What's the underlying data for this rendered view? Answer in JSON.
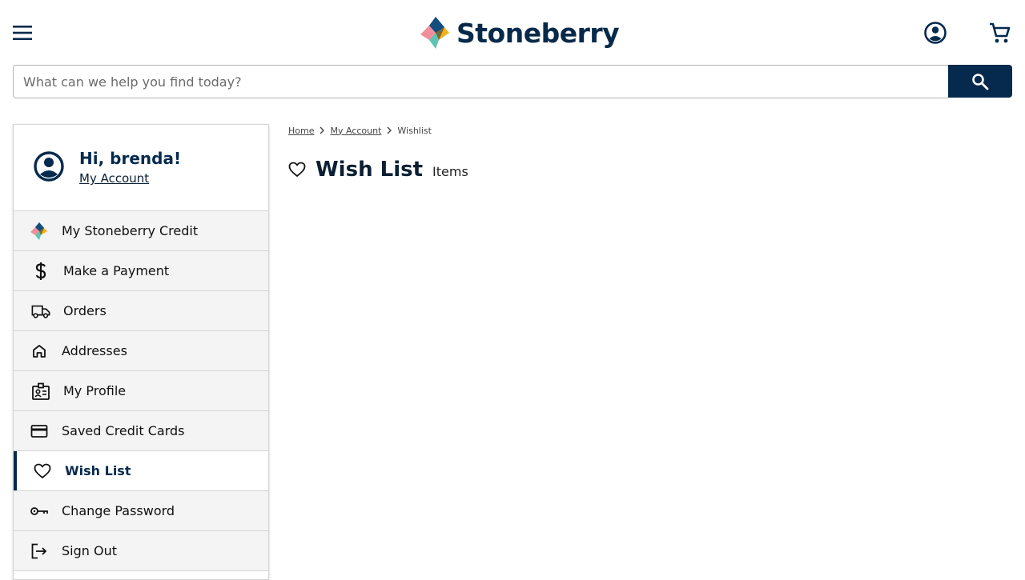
{
  "header": {
    "brand": "Stoneberry",
    "menu_icon": "hamburger-menu-icon",
    "account_icon": "account-circle-icon",
    "cart_icon": "shopping-cart-icon"
  },
  "search": {
    "placeholder": "What can we help you find today?",
    "value": "",
    "icon": "search-icon"
  },
  "sidebar": {
    "greeting": "Hi, brenda!",
    "account_link": "My Account",
    "items": [
      {
        "label": "My Stoneberry Credit",
        "icon": "stoneberry-logo-icon"
      },
      {
        "label": "Make a Payment",
        "icon": "dollar-icon"
      },
      {
        "label": "Orders",
        "icon": "truck-icon"
      },
      {
        "label": "Addresses",
        "icon": "home-icon"
      },
      {
        "label": "My Profile",
        "icon": "profile-badge-icon"
      },
      {
        "label": "Saved Credit Cards",
        "icon": "credit-card-icon"
      },
      {
        "label": "Wish List",
        "icon": "heart-icon",
        "active": true
      },
      {
        "label": "Change Password",
        "icon": "key-icon"
      },
      {
        "label": "Sign Out",
        "icon": "sign-out-icon"
      }
    ]
  },
  "breadcrumb": {
    "items": [
      "Home",
      "My Account",
      "Wishlist"
    ]
  },
  "main": {
    "title": "Wish List",
    "items_label": "Items"
  },
  "colors": {
    "brand_navy": "#062a4d",
    "nav_bg": "#f4f4f4",
    "logo_blue": "#1f6fb5",
    "logo_yellow": "#f5b21a",
    "logo_pink": "#f08f9b",
    "logo_teal": "#5fc3b3"
  }
}
